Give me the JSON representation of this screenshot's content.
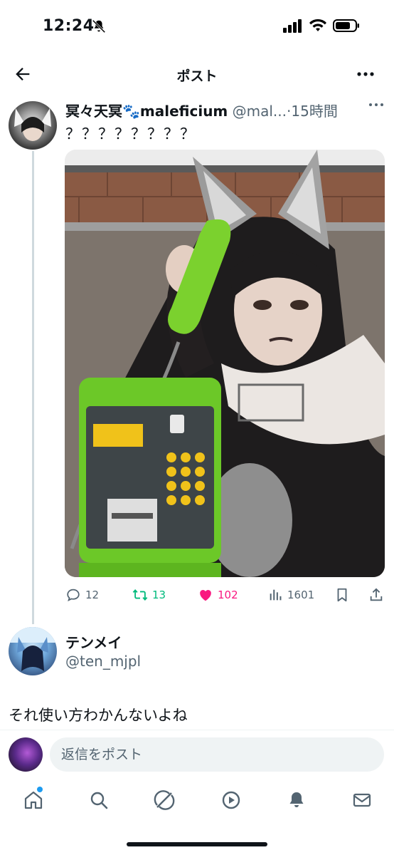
{
  "status_bar": {
    "time": "12:24"
  },
  "header": {
    "title": "ポスト"
  },
  "tweet": {
    "display_name": "冥々天冥🐾maleficium",
    "handle": "@mal...",
    "separator": "·",
    "time": "15時間",
    "text": "？？？？？？？？",
    "actions": {
      "replies": "12",
      "reposts": "13",
      "likes": "102",
      "views": "1601"
    }
  },
  "reply": {
    "display_name": "テンメイ",
    "handle": "@ten_mjpl",
    "text": "それ使い方わかんないよね"
  },
  "compose": {
    "placeholder": "返信をポスト"
  },
  "colors": {
    "accent": "#1d9bf0",
    "repost": "#00ba7c",
    "like": "#f91880",
    "secondary": "#536471"
  },
  "tabs": [
    "home-icon",
    "search-icon",
    "grok-icon",
    "video-icon",
    "notifications-icon",
    "messages-icon"
  ]
}
